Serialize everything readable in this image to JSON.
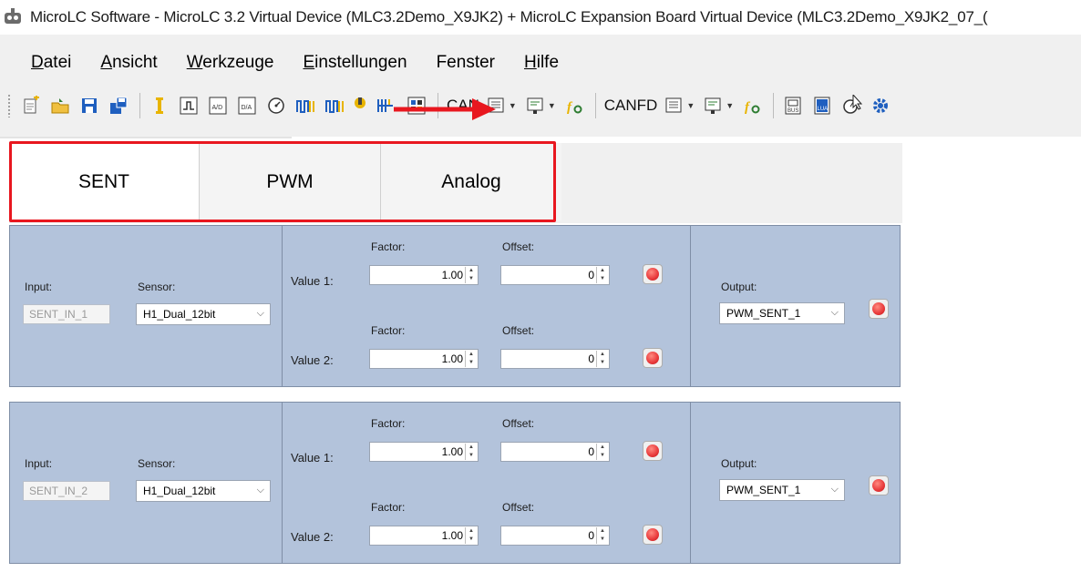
{
  "window": {
    "title": "MicroLC Software - MicroLC 3.2 Virtual Device (MLC3.2Demo_X9JK2) + MicroLC Expansion Board Virtual Device (MLC3.2Demo_X9JK2_07_("
  },
  "menu": [
    {
      "label": "Datei",
      "accel": "D",
      "rest": "atei"
    },
    {
      "label": "Ansicht",
      "accel": "A",
      "rest": "nsicht"
    },
    {
      "label": "Werkzeuge",
      "accel": "W",
      "rest": "erkzeuge"
    },
    {
      "label": "Einstellungen",
      "accel": "E",
      "rest": "instellungen"
    },
    {
      "label": "Fenster",
      "accel": "",
      "rest": "Fenster"
    },
    {
      "label": "Hilfe",
      "accel": "H",
      "rest": "ilfe"
    }
  ],
  "toolbar": {
    "can_label": "CAN",
    "canfd_label": "CANFD",
    "icons": [
      "new-project-icon",
      "open-folder-icon",
      "save-icon",
      "save-as-icon",
      "io-icon",
      "pulse-icon",
      "ad-icon",
      "da-icon",
      "gauge-icon",
      "pwm-in-icon",
      "pwm-out-icon",
      "warning-icon",
      "network-icon",
      "sent-config-icon"
    ],
    "colors": {
      "accent_red": "#e8171f",
      "icon_blue": "#1f5fbf",
      "icon_yellow": "#e8b400"
    }
  },
  "tabs": [
    {
      "label": "SENT",
      "selected": true
    },
    {
      "label": "PWM",
      "selected": false
    },
    {
      "label": "Analog",
      "selected": false
    }
  ],
  "rows": [
    {
      "input_label": "Input:",
      "input_value": "SENT_IN_1",
      "sensor_label": "Sensor:",
      "sensor_value": "H1_Dual_12bit",
      "value1_label": "Value 1:",
      "value2_label": "Value 2:",
      "factor_label": "Factor:",
      "offset_label": "Offset:",
      "factor1": "1.00",
      "offset1": "0",
      "factor2": "1.00",
      "offset2": "0",
      "output_label": "Output:",
      "output_value": "PWM_SENT_1"
    },
    {
      "input_label": "Input:",
      "input_value": "SENT_IN_2",
      "sensor_label": "Sensor:",
      "sensor_value": "H1_Dual_12bit",
      "value1_label": "Value 1:",
      "value2_label": "Value 2:",
      "factor_label": "Factor:",
      "offset_label": "Offset:",
      "factor1": "1.00",
      "offset1": "0",
      "factor2": "1.00",
      "offset2": "0",
      "output_label": "Output:",
      "output_value": "PWM_SENT_1"
    }
  ]
}
